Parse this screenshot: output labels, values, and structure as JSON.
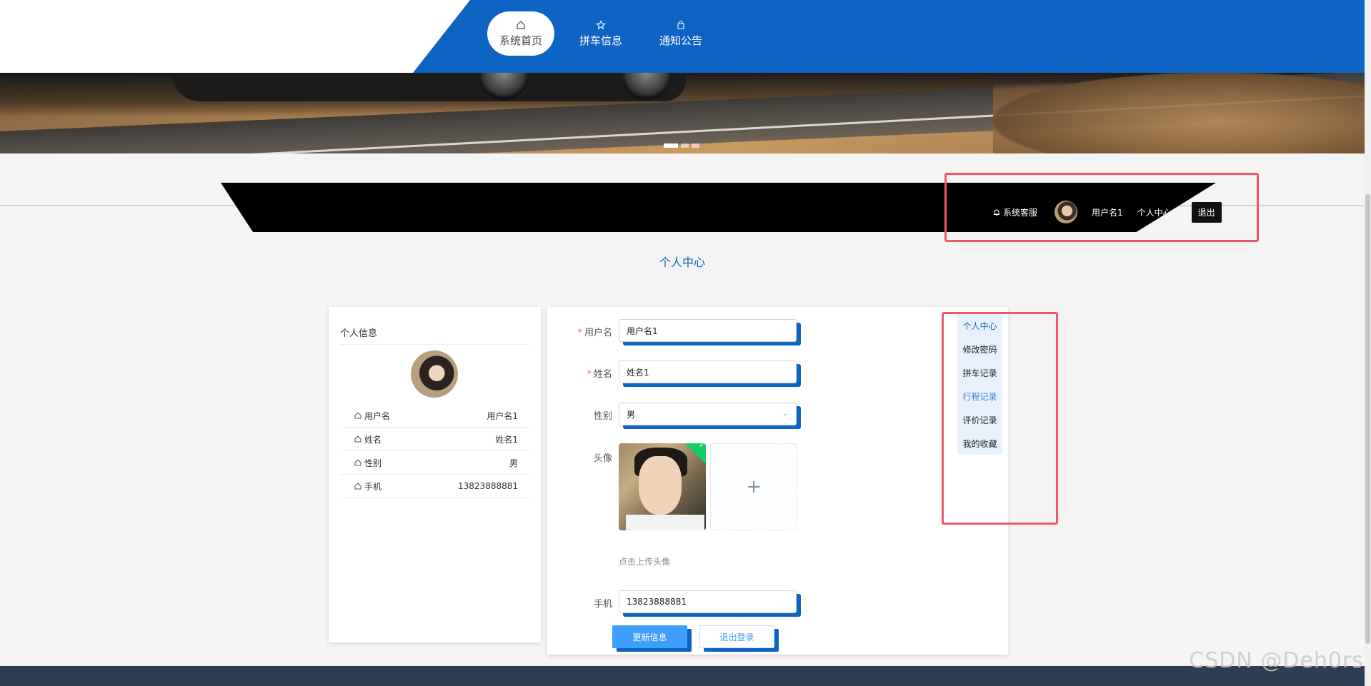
{
  "nav": {
    "items": [
      {
        "label": "系统首页",
        "icon": "home-icon",
        "active": true
      },
      {
        "label": "拼车信息",
        "icon": "star-icon",
        "active": false
      },
      {
        "label": "通知公告",
        "icon": "bag-icon",
        "active": false
      }
    ]
  },
  "banner": {
    "carousel_count": 3,
    "active_index": 0
  },
  "userbar": {
    "service_label": "系统客服",
    "username": "用户名1",
    "center_label": "个人中心",
    "logout_label": "退出"
  },
  "page": {
    "title": "个人中心"
  },
  "profile_card": {
    "title": "个人信息",
    "rows": [
      {
        "label": "用户名",
        "value": "用户名1"
      },
      {
        "label": "姓名",
        "value": "姓名1"
      },
      {
        "label": "性别",
        "value": "男"
      },
      {
        "label": "手机",
        "value": "13823888881"
      }
    ]
  },
  "form": {
    "username_label": "用户名",
    "username_value": "用户名1",
    "name_label": "姓名",
    "name_value": "姓名1",
    "gender_label": "性别",
    "gender_value": "男",
    "avatar_label": "头像",
    "upload_hint": "点击上传头像",
    "phone_label": "手机",
    "phone_value": "13823888881",
    "update_button": "更新信息",
    "logout_button": "退出登录"
  },
  "side_menu": {
    "items": [
      {
        "label": "个人中心",
        "state": "active"
      },
      {
        "label": "修改密码",
        "state": "normal"
      },
      {
        "label": "拼车记录",
        "state": "normal"
      },
      {
        "label": "行程记录",
        "state": "hover"
      },
      {
        "label": "评价记录",
        "state": "normal"
      },
      {
        "label": "我的收藏",
        "state": "normal"
      }
    ]
  },
  "watermark": "CSDN @Deh0rs",
  "colors": {
    "brand_blue": "#0d64c3",
    "primary_button": "#409eff",
    "highlight_red": "#f0566e",
    "footer": "#2d3e50"
  }
}
